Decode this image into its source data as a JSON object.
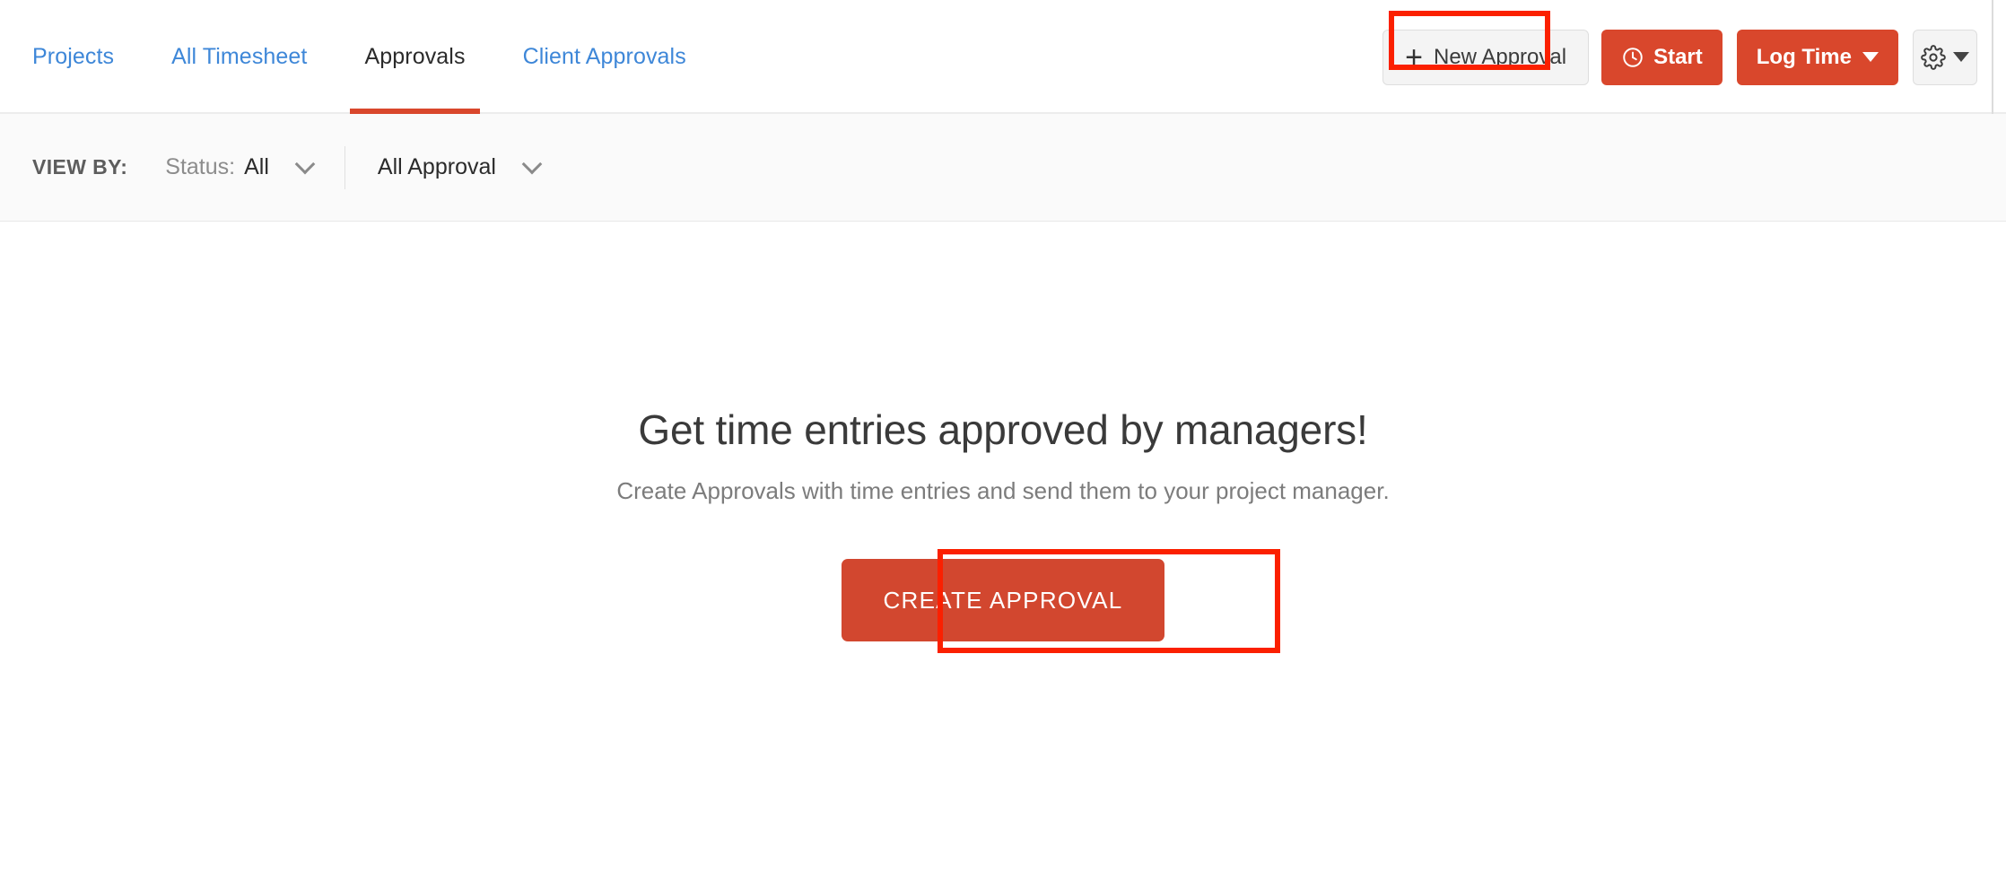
{
  "nav": {
    "tabs": [
      {
        "label": "Projects",
        "active": false
      },
      {
        "label": "All Timesheet",
        "active": false
      },
      {
        "label": "Approvals",
        "active": true
      },
      {
        "label": "Client Approvals",
        "active": false
      }
    ]
  },
  "actions": {
    "new_approval_label": "New Approval",
    "new_approval_plus": "+",
    "start_label": "Start",
    "log_time_label": "Log Time",
    "settings_icon": "gear-icon"
  },
  "filters": {
    "view_by_label": "VIEW BY:",
    "status": {
      "prefix": "Status:",
      "value": "All"
    },
    "approval": {
      "value": "All Approval"
    }
  },
  "empty_state": {
    "title": "Get time entries approved by managers!",
    "subtitle": "Create Approvals with time entries and send them to your project manager.",
    "cta_label": "CREATE APPROVAL"
  },
  "colors": {
    "accent": "#d9472c",
    "cta": "#d2472f",
    "link": "#3e87d8",
    "annotation": "#fb2000",
    "filter_bg": "#fafafa"
  }
}
